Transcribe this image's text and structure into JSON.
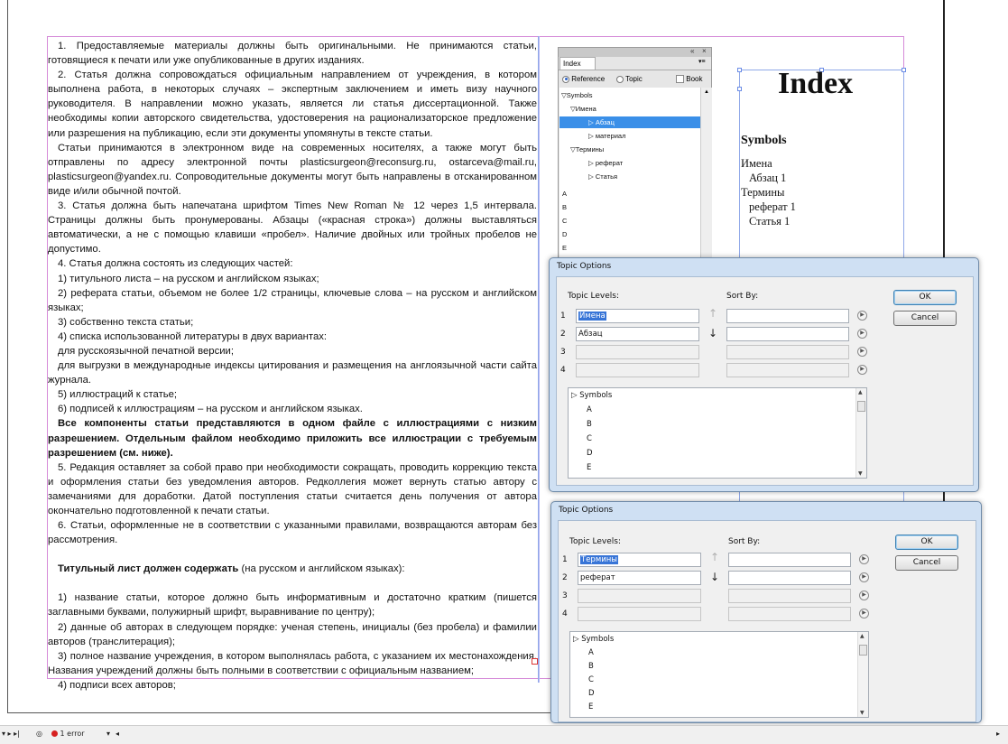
{
  "document": {
    "paragraphs": [
      {
        "text": "1. Предоставляемые материалы должны быть оригинальными. Не принимаются статьи, готовящиеся к печати или уже опубликованные в других изданиях.",
        "style": "normal"
      },
      {
        "text": "2. Статья должна сопровождаться официальным направлением от учреждения, в котором выполнена работа, в некоторых случаях – экспертным заключением и иметь визу научного руководителя. В направлении можно указать, является ли статья диссертационной. Также необходимы копии авторского свидетельства, удостоверения на рационализаторское предложение или разрешения на публикацию, если эти документы упомянуты в тексте статьи.",
        "style": "normal"
      },
      {
        "text": "Статьи принимаются в электронном виде на современных носителях, а также могут быть отправлены по адресу электронной почты plasticsurgeon@reconsurg.ru, ostarceva@mail.ru, plasticsurgeon@yandex.ru. Сопроводительные документы могут быть направлены в отсканированном виде и/или обычной почтой.",
        "style": "normal"
      },
      {
        "text": "3. Статья должна быть напечатана шрифтом Times New Roman № 12 через 1,5 интервала. Страницы должны быть пронумерованы. Абзацы («красная строка») должны выставляться автоматически, а не с помощью клавиши «пробел». Наличие двойных или тройных пробелов не допустимо.",
        "style": "normal"
      },
      {
        "text": "4. Статья должна состоять из следующих частей:",
        "style": "normal"
      },
      {
        "text": "1) титульного листа – на русском и английском языках;",
        "style": "normal"
      },
      {
        "text": "2) реферата статьи, объемом не более 1/2 страницы, ключевые слова – на русском и английском языках;",
        "style": "normal"
      },
      {
        "text": "3) собственно текста статьи;",
        "style": "normal"
      },
      {
        "text": "4) списка использованной литературы в двух вариантах:",
        "style": "normal"
      },
      {
        "text": "для русскоязычной печатной версии;",
        "style": "normal"
      },
      {
        "text": "для выгрузки в международные индексы цитирования и размещения на англоязычной части сайта журнала.",
        "style": "normal"
      },
      {
        "text": "5) иллюстраций к статье;",
        "style": "normal"
      },
      {
        "text": "6) подписей к иллюстрациям – на русском и английском языках.",
        "style": "normal"
      },
      {
        "text": "Все компоненты статьи представляются в одном файле с иллюстрациями с низким разрешением. Отдельным файлом необходимо приложить все иллюстрации с требуемым разрешением (см. ниже).",
        "style": "bold"
      },
      {
        "text": "5. Редакция оставляет за собой право при необходимости сокращать, проводить коррекцию текста и оформления статьи без уведомления авторов. Редколлегия может вернуть статью автору с замечаниями для доработки. Датой поступления статьи считается день получения от автора окончательно подготовленной к печати статьи.",
        "style": "normal"
      },
      {
        "text": "6. Статьи, оформленные не в соответствии с указанными правилами, возвращаются авторам без рассмотрения.",
        "style": "normal"
      }
    ],
    "title_block": {
      "bold": "Титульный лист должен содержать",
      "rest": " (на русском и английском языках):"
    },
    "items2": [
      "1) название статьи, которое должно быть информативным и достаточно кратким (пишется заглавными буквами, полужирный шрифт, выравнивание по центру);",
      "2) данные об авторах в следующем порядке: ученая степень, инициалы (без пробела) и фамилии авторов (транслитерация);",
      "3) полное название учреждения, в котором выполнялась работа, с указанием их местонахождения. Названия учреждений должны быть полными в соответствии с официальным названием;",
      "4) подписи всех авторов;"
    ]
  },
  "index_page": {
    "title": "Index",
    "section": "Symbols",
    "lines": [
      "Имена",
      "Абзац 1",
      "Термины",
      "реферат 1",
      "Статья 1"
    ]
  },
  "index_panel": {
    "tab": "Index",
    "collapse": "«",
    "close": "×",
    "menu": "▾≡",
    "reference_label": "Reference",
    "topic_label": "Topic",
    "book_label": "Book",
    "tree": [
      "Symbols",
      "Имена",
      "Абзац",
      "материал",
      "Термины",
      "реферат",
      "Статья",
      "A",
      "B",
      "C",
      "D",
      "E"
    ]
  },
  "dialog1": {
    "title": "Topic Options",
    "topic_levels_label": "Topic Levels:",
    "sort_by_label": "Sort By:",
    "levels": [
      {
        "num": "1",
        "value": "Имена",
        "selected": true
      },
      {
        "num": "2",
        "value": "Абзац",
        "selected": false
      },
      {
        "num": "3",
        "value": "",
        "selected": false
      },
      {
        "num": "4",
        "value": "",
        "selected": false
      }
    ],
    "ok": "OK",
    "cancel": "Cancel",
    "tree": [
      "Symbols",
      "A",
      "B",
      "C",
      "D",
      "E"
    ]
  },
  "dialog2": {
    "title": "Topic Options",
    "topic_levels_label": "Topic Levels:",
    "sort_by_label": "Sort By:",
    "levels": [
      {
        "num": "1",
        "value": "Термины",
        "selected": true
      },
      {
        "num": "2",
        "value": "реферат",
        "selected": false
      },
      {
        "num": "3",
        "value": "",
        "selected": false
      },
      {
        "num": "4",
        "value": "",
        "selected": false
      }
    ],
    "ok": "OK",
    "cancel": "Cancel",
    "tree": [
      "Symbols",
      "A",
      "B",
      "C",
      "D",
      "E"
    ]
  },
  "statusbar": {
    "error_text": "1 error"
  }
}
